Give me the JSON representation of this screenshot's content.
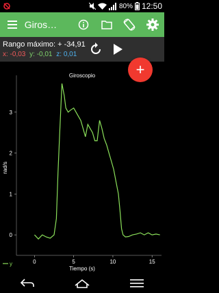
{
  "statusbar": {
    "battery_pct": "80%",
    "clock": "12:50"
  },
  "toolbar": {
    "title": "Giros…",
    "icons": [
      "menu-icon",
      "info-icon",
      "folder-icon",
      "rotate-icon",
      "gear-icon"
    ]
  },
  "info": {
    "range": "Rango máximo: + -34,91",
    "x": "x: -0,03",
    "y": "y: -0,01",
    "z": "z: 0,01"
  },
  "fab": {
    "label": "+"
  },
  "colors": {
    "accent": "#5cb85c",
    "line": "#8be05a",
    "x": "#f05a5a",
    "y": "#7fd36b",
    "z": "#4fb3f0",
    "fab": "#f1392f"
  },
  "chart_data": {
    "type": "line",
    "title": "Giroscopio",
    "xlabel": "Tiempo (s)",
    "ylabel": "rad/s",
    "xlim": [
      -2.3,
      16.2
    ],
    "ylim": [
      -0.5,
      3.9
    ],
    "xticks": [
      0,
      5,
      10,
      15
    ],
    "yticks": [
      0,
      1,
      2,
      3
    ],
    "legend": "y",
    "series": [
      {
        "name": "y",
        "x": [
          0.0,
          0.5,
          1.0,
          1.5,
          2.0,
          2.5,
          2.8,
          3.0,
          3.2,
          3.5,
          3.8,
          4.0,
          4.3,
          4.6,
          5.0,
          5.3,
          5.6,
          5.9,
          6.2,
          6.5,
          6.8,
          7.1,
          7.4,
          7.7,
          8.0,
          8.3,
          8.6,
          8.9,
          9.2,
          9.5,
          9.8,
          10.1,
          10.4,
          10.7,
          10.9,
          11.1,
          11.3,
          11.6,
          12.0,
          12.5,
          13.0,
          13.5,
          14.0,
          14.5,
          15.0,
          15.5,
          16.0
        ],
        "y": [
          0.0,
          -0.1,
          0.0,
          -0.05,
          -0.08,
          0.0,
          0.4,
          1.5,
          2.4,
          3.7,
          3.4,
          3.1,
          3.0,
          3.05,
          3.1,
          3.0,
          2.9,
          2.8,
          2.6,
          2.4,
          2.7,
          2.6,
          2.5,
          2.3,
          2.3,
          2.8,
          2.6,
          2.35,
          2.2,
          2.0,
          1.8,
          1.6,
          1.3,
          1.0,
          0.6,
          0.15,
          0.0,
          -0.05,
          -0.04,
          0.0,
          0.02,
          0.05,
          0.0,
          0.05,
          0.0,
          0.02,
          0.0
        ]
      }
    ]
  }
}
